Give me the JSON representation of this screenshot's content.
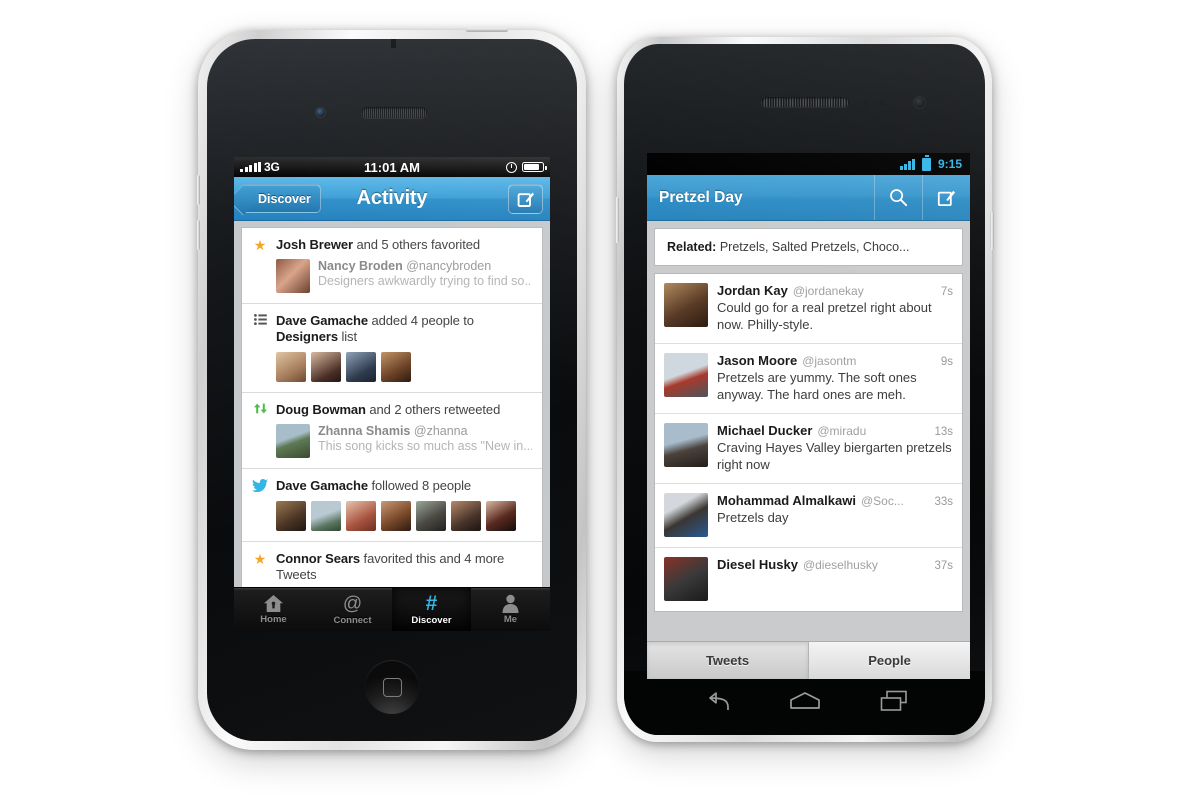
{
  "iphone": {
    "status_bar": {
      "carrier": "3G",
      "time": "11:01 AM",
      "signal_icon": "signal-bars-icon",
      "alarm_icon": "clock-icon",
      "battery_icon": "battery-icon"
    },
    "nav": {
      "back_label": "Discover",
      "title": "Activity",
      "compose_icon": "compose-icon"
    },
    "rows": [
      {
        "glyph": "star-icon",
        "headline_bold": "Josh Brewer",
        "headline_rest": " and 5 others favorited",
        "sub": {
          "name": "Nancy Broden",
          "handle": "@nancybroden",
          "body": "Designers awkwardly trying to find so...",
          "avatar_color1": "#8d5a46",
          "avatar_color2": "#d9a48a"
        },
        "avatars": []
      },
      {
        "glyph": "list-icon",
        "headline_bold": "Dave Gamache",
        "headline_rest": " added 4 people to ",
        "headline_bold2": "Designers",
        "headline_rest2": " list",
        "avatars": [
          "#d5b79a",
          "#5d4238",
          "#3b4a5e",
          "#6b4a30"
        ]
      },
      {
        "glyph": "retweet-icon",
        "headline_bold": "Doug Bowman",
        "headline_rest": " and 2 others retweeted",
        "sub": {
          "name": "Zhanna Shamis",
          "handle": "@zhanna",
          "body": "This song kicks so much ass \"New in...",
          "avatar_color1": "#6f8a6a",
          "avatar_color2": "#a7bdc9"
        },
        "avatars": []
      },
      {
        "glyph": "bird-icon",
        "headline_bold": "Dave Gamache",
        "headline_rest": " followed 8 people",
        "avatars": [
          "#6b4a33",
          "#7f9aa6",
          "#c9a392",
          "#8a5c42",
          "#4e4a45",
          "#3d3a38",
          "#2b2422"
        ]
      },
      {
        "glyph": "star-icon",
        "headline_bold": "Connor Sears",
        "headline_rest": " favorited this and 4 more Tweets",
        "avatars": []
      }
    ],
    "tabs": [
      {
        "label": "Home",
        "icon": "home-icon",
        "active": false
      },
      {
        "label": "Connect",
        "icon": "at-icon",
        "active": false
      },
      {
        "label": "Discover",
        "icon": "hashtag-icon",
        "active": true
      },
      {
        "label": "Me",
        "icon": "person-icon",
        "active": false
      }
    ],
    "home_button_icon": "home-button-icon"
  },
  "android": {
    "status_bar": {
      "time": "9:15",
      "signal_icon": "signal-bars-icon",
      "battery_icon": "battery-icon"
    },
    "action_bar": {
      "title": "Pretzel Day",
      "search_icon": "search-icon",
      "compose_icon": "compose-icon"
    },
    "related": {
      "label": "Related:",
      "value": "Pretzels, Salted Pretzels, Choco..."
    },
    "tweets": [
      {
        "name": "Jordan Kay",
        "handle": "@jordanekay",
        "time": "7s",
        "text": "Could go for a real pretzel right about now. Philly-style.",
        "avatar_color1": "#7a5a3c",
        "avatar_color2": "#c89a72"
      },
      {
        "name": "Jason Moore",
        "handle": "@jasontm",
        "time": "9s",
        "text": "Pretzels are yummy. The soft ones anyway. The hard ones are meh.",
        "avatar_color1": "#b8c3cc",
        "avatar_color2": "#9e3b2e"
      },
      {
        "name": "Michael Ducker",
        "handle": "@miradu",
        "time": "13s",
        "text": "Craving Hayes Valley biergarten pretzels right now",
        "avatar_color1": "#8fa6b8",
        "avatar_color2": "#3a3430"
      },
      {
        "name": "Mohammad Almalkawi",
        "handle": "@Soc...",
        "time": "33s",
        "text": "Pretzels day",
        "avatar_color1": "#c8ccd0",
        "avatar_color2": "#2b4a7a"
      },
      {
        "name": "Diesel Husky",
        "handle": "@dieselhusky",
        "time": "37s",
        "text": "",
        "avatar_color1": "#4a4a4a",
        "avatar_color2": "#a03028"
      }
    ],
    "tabs": [
      {
        "label": "Tweets",
        "selected": true
      },
      {
        "label": "People",
        "selected": false
      }
    ],
    "nav_buttons": [
      {
        "icon": "back-icon"
      },
      {
        "icon": "home-icon"
      },
      {
        "icon": "recents-icon"
      }
    ]
  },
  "colors": {
    "twitter_blue": "#33b5e5",
    "ios_nav_blue": "#3d9fd6",
    "star_orange": "#f5a623",
    "retweet_green": "#4cbb47"
  }
}
